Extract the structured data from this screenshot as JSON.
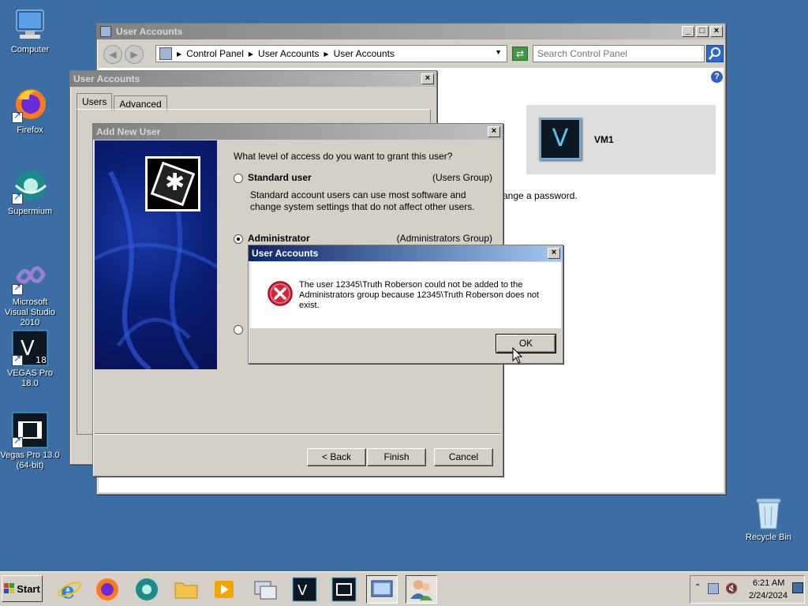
{
  "desktop": {
    "icons": [
      {
        "label": "Computer"
      },
      {
        "label": "Firefox"
      },
      {
        "label": "Supermium"
      },
      {
        "label": "Microsoft Visual Studio 2010"
      },
      {
        "label": "VEGAS Pro 18.0"
      },
      {
        "label": "Vegas Pro 13.0 (64-bit)"
      },
      {
        "label": "Recycle Bin"
      }
    ]
  },
  "cp_window": {
    "title": "User Accounts",
    "address": {
      "segments": [
        "Control Panel",
        "User Accounts",
        "User Accounts"
      ]
    },
    "search": {
      "placeholder": "Search Control Panel"
    },
    "user_tile": {
      "name": "VM1",
      "glyph": "V"
    },
    "partial_text": "ange a password."
  },
  "ua_dialog": {
    "title": "User Accounts",
    "tabs": [
      {
        "label": "Users"
      },
      {
        "label": "Advanced"
      }
    ]
  },
  "wizard": {
    "title": "Add New User",
    "question": "What level of access do you want to grant this user?",
    "options": [
      {
        "label": "Standard user",
        "group": "(Users Group)",
        "description": "Standard account users can use most software and change system settings that do not affect other users."
      },
      {
        "label": "Administrator",
        "group": "(Administrators Group)"
      }
    ],
    "buttons": {
      "back": "< Back",
      "finish": "Finish",
      "cancel": "Cancel"
    }
  },
  "error_dialog": {
    "title": "User Accounts",
    "message": "The user 12345\\Truth Roberson could not be added to the Administrators group because 12345\\Truth Roberson does not exist.",
    "ok": "OK"
  },
  "taskbar": {
    "start_label": "Start",
    "clock": {
      "time": "6:21 AM",
      "date": "2/24/2024"
    }
  },
  "colors": {
    "desktop": "#3a6ea5",
    "error_red": "#c8102e",
    "accent": "#0a246a"
  }
}
